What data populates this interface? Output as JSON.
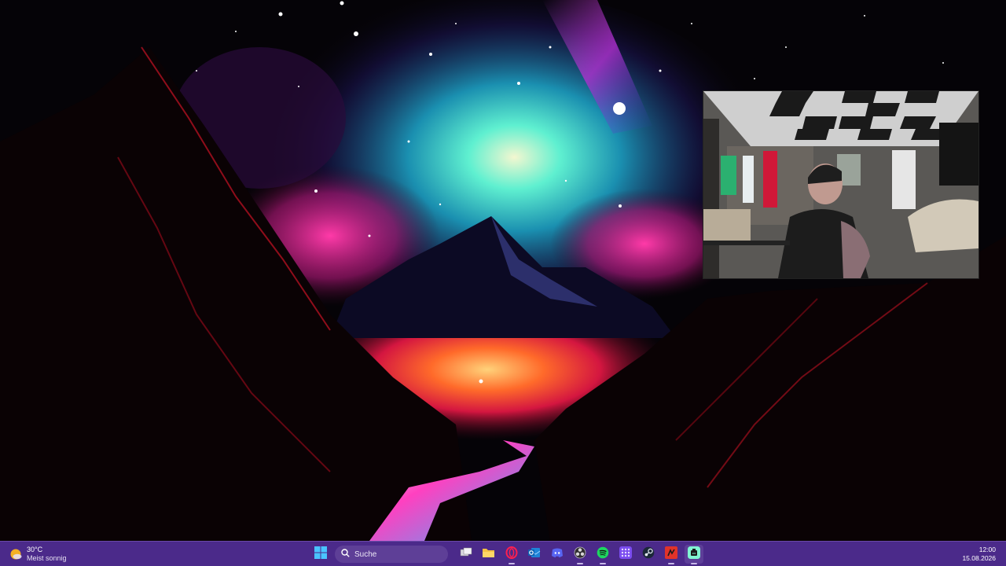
{
  "desktop": {
    "wallpaper": "night-sky-mountain-river-artwork"
  },
  "webcam": {
    "subject": "streamer-webcam-overlay"
  },
  "taskbar": {
    "background": "#4b2a8a",
    "weather": {
      "temperature": "30°C",
      "condition": "Meist sonnig",
      "icon": "sun-icon"
    },
    "search": {
      "placeholder": "Suche",
      "icon": "search-icon"
    },
    "apps": [
      {
        "name": "start-button",
        "icon": "windows-logo-icon"
      },
      {
        "name": "task-view",
        "icon": "task-view-icon"
      },
      {
        "name": "file-explorer",
        "icon": "folder-icon"
      },
      {
        "name": "opera-gx",
        "icon": "opera-icon"
      },
      {
        "name": "outlook",
        "icon": "outlook-icon"
      },
      {
        "name": "discord",
        "icon": "discord-icon"
      },
      {
        "name": "obs",
        "icon": "obs-icon"
      },
      {
        "name": "spotify",
        "icon": "spotify-icon"
      },
      {
        "name": "app-grid",
        "icon": "grid-icon"
      },
      {
        "name": "steam",
        "icon": "steam-icon"
      },
      {
        "name": "game-app",
        "icon": "game-icon"
      },
      {
        "name": "streamlabs",
        "icon": "streamlabs-icon"
      }
    ],
    "clock": {
      "time": "12:00",
      "date": "15.08.2026"
    }
  }
}
